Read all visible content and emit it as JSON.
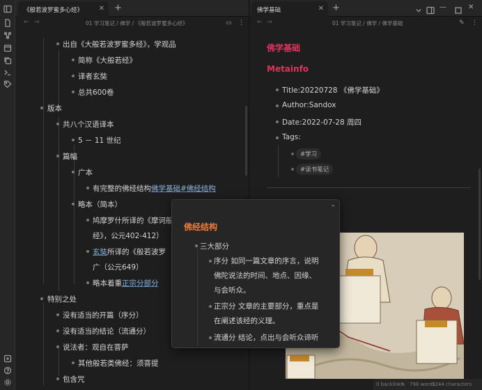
{
  "colors": {
    "accent_heading": "#e0335c",
    "popover_heading": "#ef7b36",
    "link": "#8ab4e0"
  },
  "ribbon": {
    "icons": [
      "sidebar-toggle-icon",
      "files-icon",
      "graph-icon",
      "calendar-icon",
      "copy-icon",
      "terminal-icon",
      "tags-icon",
      "help-icon",
      "settings-icon"
    ]
  },
  "left": {
    "tab_title": "《般若波罗蜜多心经》",
    "breadcrumb": "01 学习笔记 / 佛学 / 《般若波罗蜜多心经》",
    "items": {
      "i1": "出自《大般若波罗蜜多经》，学观品",
      "i2": "简称《大般若经》",
      "i3": "译者玄奘",
      "i4": "总共600卷",
      "i5": "版本",
      "i6": "共八个汉语译本",
      "i7": "5 － 11 世纪",
      "i8": "篇幅",
      "i9": "广本",
      "i10_pre": "有完整的佛经结构",
      "i10_link": "佛学基础#佛经结构",
      "i11": "略本（简本）",
      "i12a": "鸠摩罗什所译的《摩诃般",
      "i12b": "经》，公元402-412）",
      "i13_link": "玄奘",
      "i13a": "所译的《般若波罗",
      "i13b": "广（公元649）",
      "i14_pre": "略本着重",
      "i14_link": "正宗分部分",
      "i15": "特别之处",
      "i16": "没有适当的开篇（序分）",
      "i17": "没有适当的结论（流通分）",
      "i18": "说法者：观自在菩萨",
      "i19": "其他般若类佛经：须菩提",
      "i20": "包含咒"
    }
  },
  "right": {
    "tab_title": "佛学基础",
    "breadcrumb": "01 学习笔记 / 佛学 / 佛学基础",
    "heading1": "佛学基础",
    "heading2": "Metainfo",
    "title": "Title:20220728 《佛学基础》",
    "author": "Author:Sandox",
    "date": "Date:2022-07-28 周四",
    "tags_label": "Tags:",
    "tag1": "#学习",
    "tag2": "#读书笔记"
  },
  "popover": {
    "heading": "佛经结构",
    "p1": "三大部分",
    "p2a": "序分 如同一篇文章的序言，说明",
    "p2b": "佛陀说法的时间、地点、因缘、",
    "p2c": "与会听众。",
    "p3a": "正宗分 文章的主要部分，重点是",
    "p3b": "在阐述该经的义理。",
    "p4a": "流通分 结论，点出与会听众谛听"
  },
  "status": {
    "backlinks": "0 backlinks",
    "words": "798 words",
    "characters": "3244 characters"
  }
}
